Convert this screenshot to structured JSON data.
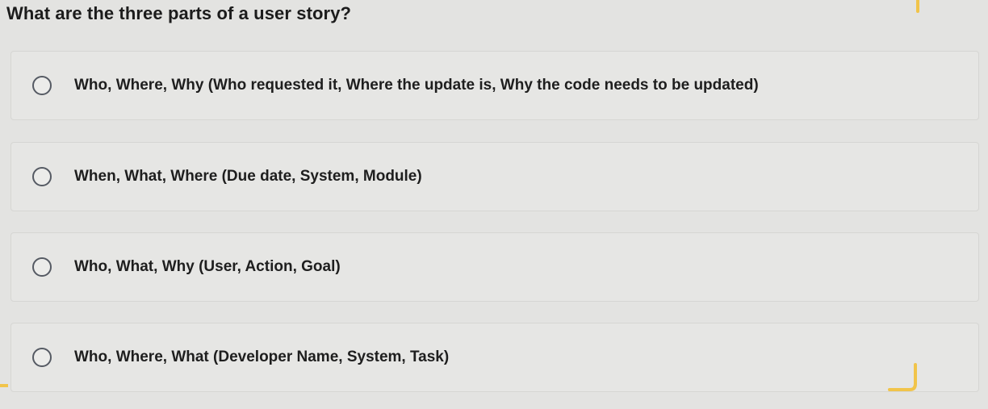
{
  "question": {
    "text": "What are the three parts of a user story?"
  },
  "options": [
    {
      "label": "Who, Where, Why (Who requested it, Where the update is, Why the code needs to be updated)",
      "selected": false
    },
    {
      "label": "When, What, Where (Due date, System, Module)",
      "selected": false
    },
    {
      "label": "Who, What, Why (User, Action, Goal)",
      "selected": false
    },
    {
      "label": "Who, Where, What (Developer Name, System, Task)",
      "selected": false
    }
  ],
  "colors": {
    "background": "#e3e3e1",
    "radio_border": "#555a63",
    "highlight_mark": "#f1c44a"
  }
}
